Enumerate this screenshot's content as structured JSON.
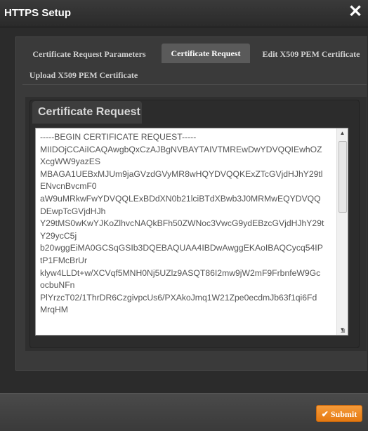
{
  "dialog": {
    "title": "HTTPS Setup",
    "close_label": "✕"
  },
  "tabs": [
    {
      "label": "Certificate Request Parameters"
    },
    {
      "label": "Certificate Request"
    },
    {
      "label": "Edit X509 PEM Certificate"
    },
    {
      "label": "Upload X509 PEM Certificate"
    }
  ],
  "section": {
    "title": "Certificate Request"
  },
  "certificate": {
    "lines": [
      "-----BEGIN CERTIFICATE REQUEST-----",
      "MIIDOjCCAiICAQAwgbQxCzAJBgNVBAYTAIVTMREwDwYDVQQIEwhOZ",
      "XcgWW9yazES",
      "MBAGA1UEBxMJUm9jaGVzdGVyMR8wHQYDVQQKExZTcGVjdHJhY29tl",
      "ENvcnBvcmF0",
      "aW9uMRkwFwYDVQQLExBDdXN0b21lciBTdXBwb3J0MRMwEQYDVQQ",
      "DEwpTcGVjdHJh",
      "Y29tMS0wKwYJKoZlhvcNAQkBFh50ZWNoc3VwcG9ydEBzcGVjdHJhY29t",
      "Y29ycC5j",
      "b20wggEiMA0GCSqGSIb3DQEBAQUAA4IBDwAwggEKAoIBAQCycq54IP",
      "tP1FMcBrUr",
      "klyw4LLDt+w/XCVqf5MNH0Nj5UZlz9ASQT86I2mw9jW2mF9FrbnfeW9Gc",
      "ocbuNFn",
      "PlYrzcT02/1ThrDR6CzgivpcUs6/PXAkoJmq1W21Zpe0ecdmJb63f1qi6Fd",
      "MrqHM"
    ]
  },
  "footer": {
    "submit_label": "Submit",
    "submit_icon": "check-icon",
    "accent_color": "#f08a24"
  }
}
